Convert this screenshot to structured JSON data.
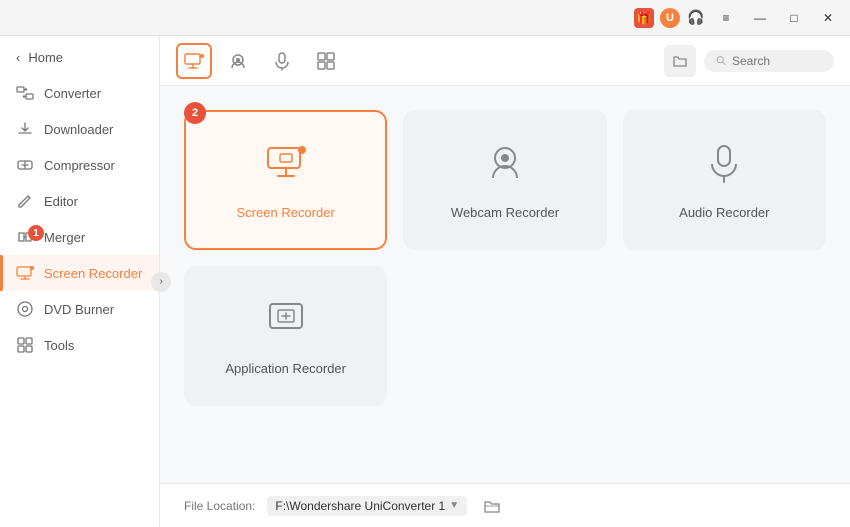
{
  "titlebar": {
    "icons": {
      "gift": "🎁",
      "user": "U",
      "headset": "🎧",
      "menu": "≡",
      "minimize": "—",
      "maximize": "□",
      "close": "✕"
    }
  },
  "sidebar": {
    "home_label": "Home",
    "items": [
      {
        "id": "converter",
        "label": "Converter",
        "badge": null
      },
      {
        "id": "downloader",
        "label": "Downloader",
        "badge": null
      },
      {
        "id": "compressor",
        "label": "Compressor",
        "badge": null
      },
      {
        "id": "editor",
        "label": "Editor",
        "badge": null
      },
      {
        "id": "merger",
        "label": "Merger",
        "badge": "1"
      },
      {
        "id": "screen-recorder",
        "label": "Screen Recorder",
        "badge": null,
        "active": true
      },
      {
        "id": "dvd-burner",
        "label": "DVD Burner",
        "badge": null
      },
      {
        "id": "tools",
        "label": "Tools",
        "badge": null
      }
    ]
  },
  "toolbar": {
    "buttons": [
      {
        "id": "screen",
        "active": true
      },
      {
        "id": "webcam",
        "active": false
      },
      {
        "id": "audio",
        "active": false
      },
      {
        "id": "apps",
        "active": false
      }
    ],
    "search_placeholder": "Search"
  },
  "recorders": [
    {
      "id": "screen-recorder",
      "label": "Screen Recorder",
      "active": true,
      "step": "2"
    },
    {
      "id": "webcam-recorder",
      "label": "Webcam Recorder",
      "active": false
    },
    {
      "id": "audio-recorder",
      "label": "Audio Recorder",
      "active": false
    },
    {
      "id": "application-recorder",
      "label": "Application Recorder",
      "active": false
    }
  ],
  "footer": {
    "file_location_label": "File Location:",
    "file_location_path": "F:\\Wondershare UniConverter 1",
    "path_arrow": "▼"
  }
}
